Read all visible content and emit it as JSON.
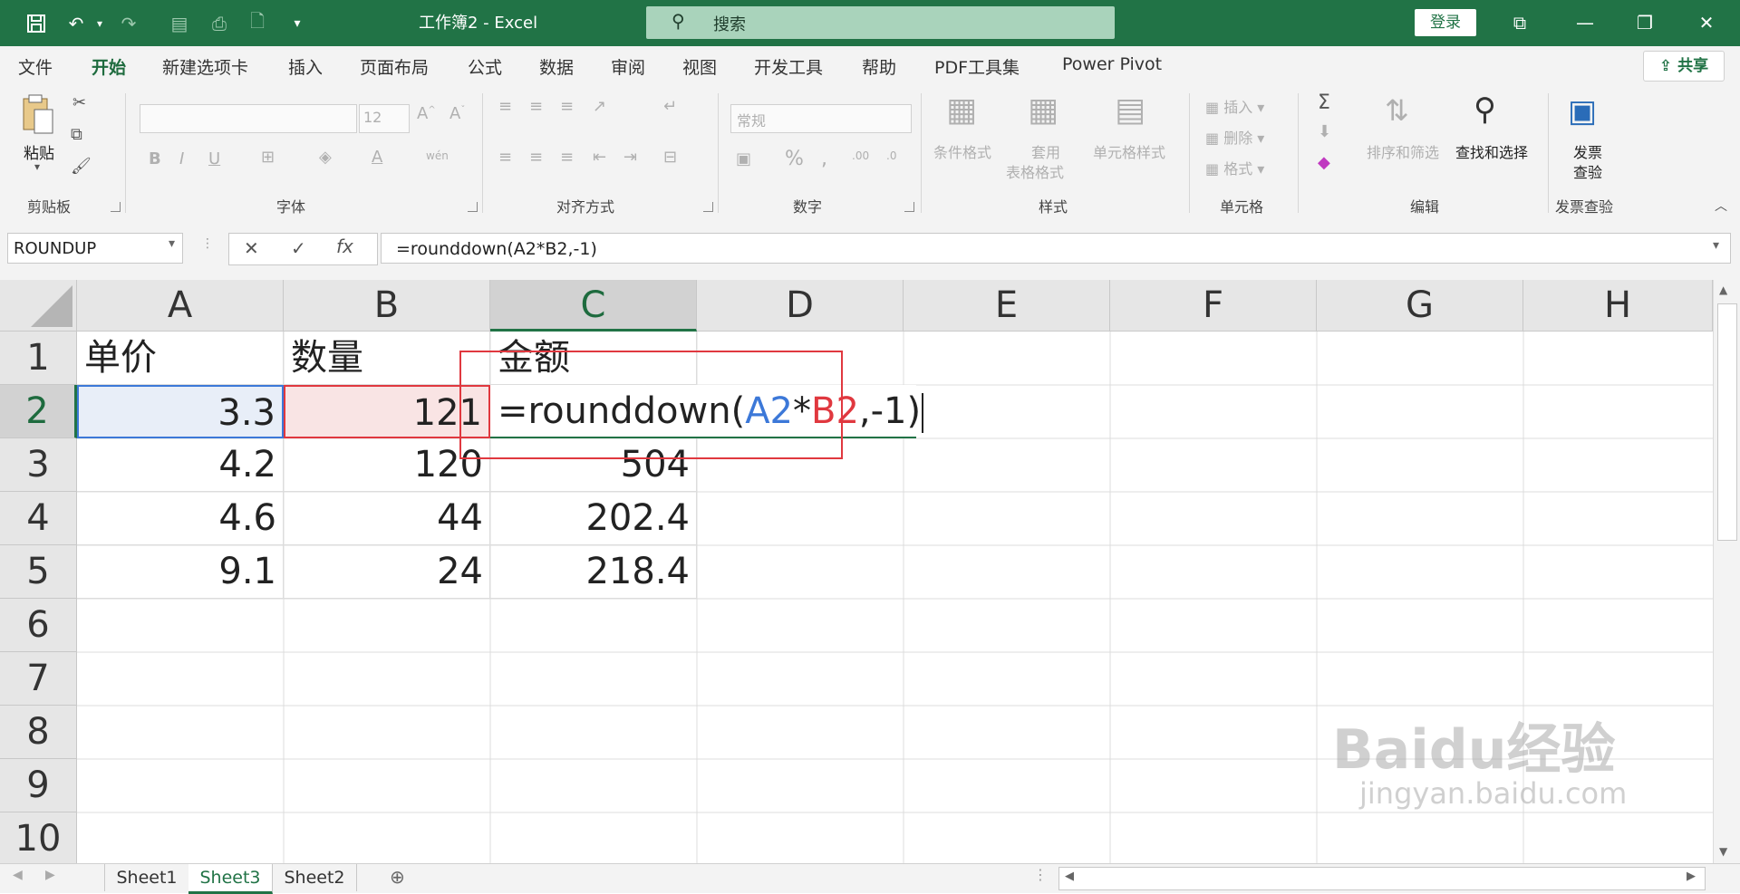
{
  "titlebar": {
    "doc_title": "工作簿2  -  Excel",
    "search_placeholder": "搜索",
    "login_label": "登录"
  },
  "tabs": [
    "文件",
    "开始",
    "新建选项卡",
    "插入",
    "页面布局",
    "公式",
    "数据",
    "审阅",
    "视图",
    "开发工具",
    "帮助",
    "PDF工具集",
    "Power Pivot"
  ],
  "share_label": "共享",
  "ribbon": {
    "clipboard": {
      "paste": "粘贴",
      "label": "剪贴板"
    },
    "font": {
      "size": "12",
      "label": "字体"
    },
    "alignment": {
      "label": "对齐方式"
    },
    "number": {
      "format": "常规",
      "label": "数字"
    },
    "styles": {
      "conditional": "条件格式",
      "table": "套用",
      "table2": "表格格式",
      "cell_styles": "单元格样式",
      "label": "样式"
    },
    "cells": {
      "insert": "插入",
      "delete": "删除",
      "format": "格式",
      "label": "单元格"
    },
    "editing": {
      "sort": "排序和筛选",
      "find": "查找和选择",
      "label": "编辑"
    },
    "invoice": {
      "line1": "发票",
      "line2": "查验",
      "label": "发票查验"
    }
  },
  "namebox": "ROUNDUP",
  "formula": "=rounddown(A2*B2,-1)",
  "columns": [
    "A",
    "B",
    "C",
    "D",
    "E",
    "F",
    "G",
    "H"
  ],
  "rows": [
    "1",
    "2",
    "3",
    "4",
    "5",
    "6",
    "7",
    "8",
    "9",
    "10"
  ],
  "cells": {
    "A1": "单价",
    "B1": "数量",
    "C1": "金额",
    "A2": "3.3",
    "B2": "121",
    "A3": "4.2",
    "B3": "120",
    "C3": "504",
    "A4": "4.6",
    "B4": "44",
    "C4": "202.4",
    "A5": "9.1",
    "B5": "24",
    "C5": "218.4"
  },
  "edit_formula": {
    "prefix": "=rounddown(",
    "ref1": "A2",
    "op": "*",
    "ref2": "B2",
    "suffix": ",-1)"
  },
  "sheets": [
    "Sheet1",
    "Sheet3",
    "Sheet2"
  ],
  "active_sheet": "Sheet3",
  "colors": {
    "excel_green": "#217346",
    "ref_blue": "#3c78d8",
    "ref_red": "#e0383f",
    "highlight_box": "#e0383f"
  },
  "watermark": {
    "brand": "Baidu经验",
    "url": "jingyan.baidu.com"
  }
}
